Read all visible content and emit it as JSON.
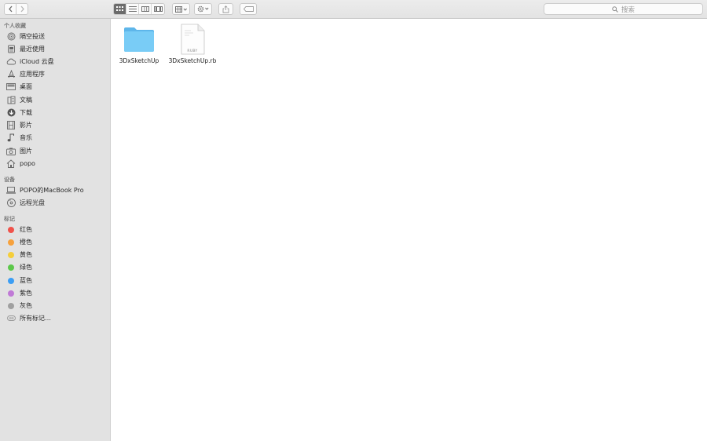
{
  "toolbar": {
    "search_placeholder": "搜索"
  },
  "sidebar": {
    "sections": [
      {
        "title": "个人收藏",
        "items": [
          {
            "label": "隔空投送",
            "icon": "airdrop-icon"
          },
          {
            "label": "最近使用",
            "icon": "recents-icon"
          },
          {
            "label": "iCloud 云盘",
            "icon": "cloud-icon"
          },
          {
            "label": "应用程序",
            "icon": "applications-icon"
          },
          {
            "label": "桌面",
            "icon": "desktop-icon"
          },
          {
            "label": "文稿",
            "icon": "documents-icon"
          },
          {
            "label": "下载",
            "icon": "downloads-icon"
          },
          {
            "label": "影片",
            "icon": "movies-icon"
          },
          {
            "label": "音乐",
            "icon": "music-icon"
          },
          {
            "label": "图片",
            "icon": "pictures-icon"
          },
          {
            "label": "popo",
            "icon": "home-icon"
          }
        ]
      },
      {
        "title": "设备",
        "items": [
          {
            "label": "POPO的MacBook Pro",
            "icon": "laptop-icon"
          },
          {
            "label": "远程光盘",
            "icon": "disc-icon"
          }
        ]
      },
      {
        "title": "标记",
        "items": [
          {
            "label": "红色",
            "color": "#f0524a"
          },
          {
            "label": "橙色",
            "color": "#f6a13c"
          },
          {
            "label": "黄色",
            "color": "#f5ce3a"
          },
          {
            "label": "绿色",
            "color": "#5cc84a"
          },
          {
            "label": "蓝色",
            "color": "#3c9ef4"
          },
          {
            "label": "紫色",
            "color": "#c07ad6"
          },
          {
            "label": "灰色",
            "color": "#a0a0a0"
          },
          {
            "label": "所有标记…",
            "icon": "all-tags-icon"
          }
        ]
      }
    ]
  },
  "files": [
    {
      "name": "3DxSketchUp",
      "kind": "folder"
    },
    {
      "name": "3DxSketchUp.rb",
      "kind": "document",
      "badge": "RUBY"
    }
  ],
  "colors": {
    "folder": "#6cc3f2",
    "selected_view": "#6b6b6b"
  }
}
